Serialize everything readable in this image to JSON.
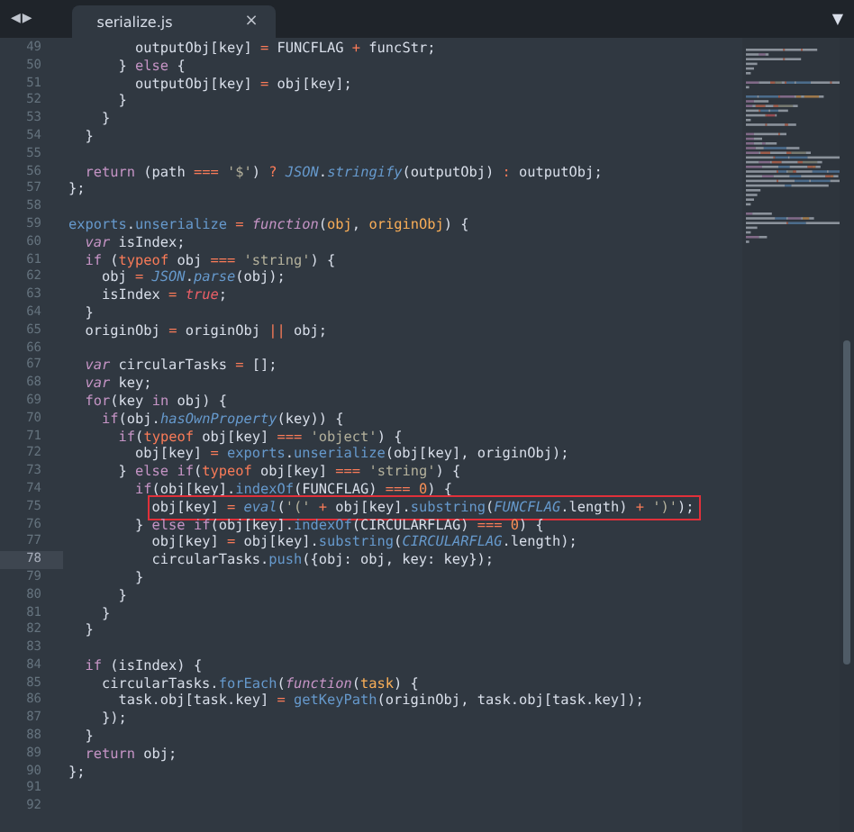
{
  "nav": {
    "back": "◀",
    "forward": "▶"
  },
  "tabs": [
    {
      "label": "serialize.js",
      "close": "×",
      "selected": true
    }
  ],
  "menu": "▼",
  "lines": [
    {
      "n": "49",
      "current": false,
      "boxed": false,
      "tokens": [
        {
          "kind": "plain",
          "text": "        outputObj[key] "
        },
        {
          "kind": "operator",
          "text": "="
        },
        {
          "kind": "plain",
          "text": " FUNCFLAG "
        },
        {
          "kind": "operator",
          "text": "+"
        },
        {
          "kind": "plain",
          "text": " funcStr;"
        }
      ]
    },
    {
      "n": "50",
      "current": false,
      "boxed": false,
      "tokens": [
        {
          "kind": "plain",
          "text": "      } "
        },
        {
          "kind": "keyword",
          "text": "else"
        },
        {
          "kind": "plain",
          "text": " {"
        }
      ]
    },
    {
      "n": "51",
      "current": false,
      "boxed": false,
      "tokens": [
        {
          "kind": "plain",
          "text": "        outputObj[key] "
        },
        {
          "kind": "operator",
          "text": "="
        },
        {
          "kind": "plain",
          "text": " obj[key];"
        }
      ]
    },
    {
      "n": "52",
      "current": false,
      "boxed": false,
      "tokens": [
        {
          "kind": "plain",
          "text": "      }"
        }
      ]
    },
    {
      "n": "53",
      "current": false,
      "boxed": false,
      "tokens": [
        {
          "kind": "plain",
          "text": "    }"
        }
      ]
    },
    {
      "n": "54",
      "current": false,
      "boxed": false,
      "tokens": [
        {
          "kind": "plain",
          "text": "  }"
        }
      ]
    },
    {
      "n": "55",
      "current": false,
      "boxed": false
    },
    {
      "n": "56",
      "current": false,
      "boxed": false,
      "tokens": [
        {
          "kind": "keyword",
          "text": "  return"
        },
        {
          "kind": "plain",
          "text": " (path "
        },
        {
          "kind": "operator",
          "text": "==="
        },
        {
          "kind": "string",
          "text": " '$'"
        },
        {
          "kind": "plain",
          "text": ") "
        },
        {
          "kind": "operator",
          "text": "?"
        },
        {
          "kind": "italic",
          "text": " JSON"
        },
        {
          "kind": "plain",
          "text": "."
        },
        {
          "kind": "italic",
          "text": "stringify"
        },
        {
          "kind": "plain",
          "text": "(outputObj) "
        },
        {
          "kind": "operator",
          "text": ":"
        },
        {
          "kind": "plain",
          "text": " outputObj;"
        }
      ]
    },
    {
      "n": "57",
      "current": false,
      "boxed": false,
      "tokens": [
        {
          "kind": "plain",
          "text": "};"
        }
      ]
    },
    {
      "n": "58",
      "current": false,
      "boxed": false
    },
    {
      "n": "59",
      "current": false,
      "boxed": false,
      "tokens": [
        {
          "kind": "name",
          "text": "exports"
        },
        {
          "kind": "plain",
          "text": "."
        },
        {
          "kind": "name",
          "text": "unserialize "
        },
        {
          "kind": "operator",
          "text": "="
        },
        {
          "kind": "storage",
          "text": " function"
        },
        {
          "kind": "plain",
          "text": "("
        },
        {
          "kind": "param",
          "text": "obj"
        },
        {
          "kind": "plain",
          "text": ", "
        },
        {
          "kind": "param",
          "text": "originObj"
        },
        {
          "kind": "plain",
          "text": ") {"
        }
      ]
    },
    {
      "n": "60",
      "current": false,
      "boxed": false,
      "tokens": [
        {
          "kind": "storage",
          "text": "  var"
        },
        {
          "kind": "plain",
          "text": " isIndex;"
        }
      ]
    },
    {
      "n": "61",
      "current": false,
      "boxed": false,
      "tokens": [
        {
          "kind": "keyword",
          "text": "  if"
        },
        {
          "kind": "plain",
          "text": " ("
        },
        {
          "kind": "operator",
          "text": "typeof"
        },
        {
          "kind": "plain",
          "text": " obj "
        },
        {
          "kind": "operator",
          "text": "==="
        },
        {
          "kind": "string",
          "text": " 'string'"
        },
        {
          "kind": "plain",
          "text": ") {"
        }
      ]
    },
    {
      "n": "62",
      "current": false,
      "boxed": false,
      "tokens": [
        {
          "kind": "plain",
          "text": "    obj "
        },
        {
          "kind": "operator",
          "text": "="
        },
        {
          "kind": "italic",
          "text": " JSON"
        },
        {
          "kind": "plain",
          "text": "."
        },
        {
          "kind": "italic",
          "text": "parse"
        },
        {
          "kind": "plain",
          "text": "(obj);"
        }
      ]
    },
    {
      "n": "63",
      "current": false,
      "boxed": false,
      "tokens": [
        {
          "kind": "plain",
          "text": "    isIndex "
        },
        {
          "kind": "operator",
          "text": "="
        },
        {
          "kind": "bool",
          "text": " true"
        },
        {
          "kind": "plain",
          "text": ";"
        }
      ]
    },
    {
      "n": "64",
      "current": false,
      "boxed": false,
      "tokens": [
        {
          "kind": "plain",
          "text": "  }"
        }
      ]
    },
    {
      "n": "65",
      "current": false,
      "boxed": false,
      "tokens": [
        {
          "kind": "plain",
          "text": "  originObj "
        },
        {
          "kind": "operator",
          "text": "="
        },
        {
          "kind": "plain",
          "text": " originObj "
        },
        {
          "kind": "operator",
          "text": "||"
        },
        {
          "kind": "plain",
          "text": " obj;"
        }
      ]
    },
    {
      "n": "66",
      "current": false,
      "boxed": false
    },
    {
      "n": "67",
      "current": false,
      "boxed": false,
      "tokens": [
        {
          "kind": "storage",
          "text": "  var"
        },
        {
          "kind": "plain",
          "text": " circularTasks "
        },
        {
          "kind": "operator",
          "text": "="
        },
        {
          "kind": "plain",
          "text": " [];"
        }
      ]
    },
    {
      "n": "68",
      "current": false,
      "boxed": false,
      "tokens": [
        {
          "kind": "storage",
          "text": "  var"
        },
        {
          "kind": "plain",
          "text": " key;"
        }
      ]
    },
    {
      "n": "69",
      "current": false,
      "boxed": false,
      "tokens": [
        {
          "kind": "keyword",
          "text": "  for"
        },
        {
          "kind": "plain",
          "text": "(key "
        },
        {
          "kind": "keyword",
          "text": "in"
        },
        {
          "kind": "plain",
          "text": " obj) {"
        }
      ]
    },
    {
      "n": "70",
      "current": false,
      "boxed": false,
      "tokens": [
        {
          "kind": "keyword",
          "text": "    if"
        },
        {
          "kind": "plain",
          "text": "(obj."
        },
        {
          "kind": "italic",
          "text": "hasOwnProperty"
        },
        {
          "kind": "plain",
          "text": "(key)) {"
        }
      ]
    },
    {
      "n": "71",
      "current": false,
      "boxed": false,
      "tokens": [
        {
          "kind": "keyword",
          "text": "      if"
        },
        {
          "kind": "plain",
          "text": "("
        },
        {
          "kind": "operator",
          "text": "typeof"
        },
        {
          "kind": "plain",
          "text": " obj[key] "
        },
        {
          "kind": "operator",
          "text": "==="
        },
        {
          "kind": "string",
          "text": " 'object'"
        },
        {
          "kind": "plain",
          "text": ") {"
        }
      ]
    },
    {
      "n": "72",
      "current": false,
      "boxed": false,
      "tokens": [
        {
          "kind": "plain",
          "text": "        obj[key] "
        },
        {
          "kind": "operator",
          "text": "="
        },
        {
          "kind": "name",
          "text": " exports"
        },
        {
          "kind": "plain",
          "text": "."
        },
        {
          "kind": "name",
          "text": "unserialize"
        },
        {
          "kind": "plain",
          "text": "(obj[key], originObj);"
        }
      ]
    },
    {
      "n": "73",
      "current": false,
      "boxed": false,
      "tokens": [
        {
          "kind": "plain",
          "text": "      } "
        },
        {
          "kind": "keyword",
          "text": "else if"
        },
        {
          "kind": "plain",
          "text": "("
        },
        {
          "kind": "operator",
          "text": "typeof"
        },
        {
          "kind": "plain",
          "text": " obj[key] "
        },
        {
          "kind": "operator",
          "text": "==="
        },
        {
          "kind": "string",
          "text": " 'string'"
        },
        {
          "kind": "plain",
          "text": ") {"
        }
      ]
    },
    {
      "n": "74",
      "current": false,
      "boxed": false,
      "tokens": [
        {
          "kind": "keyword",
          "text": "        if"
        },
        {
          "kind": "plain",
          "text": "(obj[key]."
        },
        {
          "kind": "name",
          "text": "indexOf"
        },
        {
          "kind": "plain",
          "text": "(FUNCFLAG) "
        },
        {
          "kind": "operator",
          "text": "==="
        },
        {
          "kind": "number",
          "text": " 0"
        },
        {
          "kind": "plain",
          "text": ") {"
        }
      ]
    },
    {
      "n": "75",
      "current": false,
      "boxed": true,
      "tokens": [
        {
          "kind": "plain",
          "text": "          obj[key] "
        },
        {
          "kind": "operator",
          "text": "="
        },
        {
          "kind": "italic",
          "text": " eval"
        },
        {
          "kind": "plain",
          "text": "("
        },
        {
          "kind": "string",
          "text": "'('"
        },
        {
          "kind": "operator",
          "text": " +"
        },
        {
          "kind": "plain",
          "text": " obj[key]."
        },
        {
          "kind": "name",
          "text": "substring"
        },
        {
          "kind": "plain",
          "text": "("
        },
        {
          "kind": "italic",
          "text": "FUNCFLAG"
        },
        {
          "kind": "plain",
          "text": ".length) "
        },
        {
          "kind": "operator",
          "text": "+"
        },
        {
          "kind": "string",
          "text": " ')'"
        },
        {
          "kind": "plain",
          "text": ");"
        }
      ]
    },
    {
      "n": "76",
      "current": false,
      "boxed": false,
      "tokens": [
        {
          "kind": "plain",
          "text": "        } "
        },
        {
          "kind": "keyword",
          "text": "else if"
        },
        {
          "kind": "plain",
          "text": "(obj[key]."
        },
        {
          "kind": "name",
          "text": "indexOf"
        },
        {
          "kind": "plain",
          "text": "(CIRCULARFLAG) "
        },
        {
          "kind": "operator",
          "text": "==="
        },
        {
          "kind": "number",
          "text": " 0"
        },
        {
          "kind": "plain",
          "text": ") {"
        }
      ]
    },
    {
      "n": "77",
      "current": false,
      "boxed": false,
      "tokens": [
        {
          "kind": "plain",
          "text": "          obj[key] "
        },
        {
          "kind": "operator",
          "text": "="
        },
        {
          "kind": "plain",
          "text": " obj[key]."
        },
        {
          "kind": "name",
          "text": "substring"
        },
        {
          "kind": "plain",
          "text": "("
        },
        {
          "kind": "italic",
          "text": "CIRCULARFLAG"
        },
        {
          "kind": "plain",
          "text": ".length);"
        }
      ]
    },
    {
      "n": "78",
      "current": true,
      "boxed": false,
      "tokens": [
        {
          "kind": "plain",
          "text": "          circularTasks."
        },
        {
          "kind": "name",
          "text": "push"
        },
        {
          "kind": "plain",
          "text": "({obj: obj, key: key});"
        }
      ]
    },
    {
      "n": "79",
      "current": false,
      "boxed": false,
      "tokens": [
        {
          "kind": "plain",
          "text": "        }"
        }
      ]
    },
    {
      "n": "80",
      "current": false,
      "boxed": false,
      "tokens": [
        {
          "kind": "plain",
          "text": "      }"
        }
      ]
    },
    {
      "n": "81",
      "current": false,
      "boxed": false,
      "tokens": [
        {
          "kind": "plain",
          "text": "    }"
        }
      ]
    },
    {
      "n": "82",
      "current": false,
      "boxed": false,
      "tokens": [
        {
          "kind": "plain",
          "text": "  }"
        }
      ]
    },
    {
      "n": "83",
      "current": false,
      "boxed": false
    },
    {
      "n": "84",
      "current": false,
      "boxed": false,
      "tokens": [
        {
          "kind": "keyword",
          "text": "  if"
        },
        {
          "kind": "plain",
          "text": " (isIndex) {"
        }
      ]
    },
    {
      "n": "85",
      "current": false,
      "boxed": false,
      "tokens": [
        {
          "kind": "plain",
          "text": "    circularTasks."
        },
        {
          "kind": "name",
          "text": "forEach"
        },
        {
          "kind": "plain",
          "text": "("
        },
        {
          "kind": "storage",
          "text": "function"
        },
        {
          "kind": "plain",
          "text": "("
        },
        {
          "kind": "param",
          "text": "task"
        },
        {
          "kind": "plain",
          "text": ") {"
        }
      ]
    },
    {
      "n": "86",
      "current": false,
      "boxed": false,
      "tokens": [
        {
          "kind": "plain",
          "text": "      task.obj[task.key] "
        },
        {
          "kind": "operator",
          "text": "="
        },
        {
          "kind": "name",
          "text": " getKeyPath"
        },
        {
          "kind": "plain",
          "text": "(originObj, task.obj[task.key]);"
        }
      ]
    },
    {
      "n": "87",
      "current": false,
      "boxed": false,
      "tokens": [
        {
          "kind": "plain",
          "text": "    });"
        }
      ]
    },
    {
      "n": "88",
      "current": false,
      "boxed": false,
      "tokens": [
        {
          "kind": "plain",
          "text": "  }"
        }
      ]
    },
    {
      "n": "89",
      "current": false,
      "boxed": false,
      "tokens": [
        {
          "kind": "keyword",
          "text": "  return"
        },
        {
          "kind": "plain",
          "text": " obj;"
        }
      ]
    },
    {
      "n": "90",
      "current": false,
      "boxed": false,
      "tokens": [
        {
          "kind": "plain",
          "text": "};"
        }
      ]
    },
    {
      "n": "91",
      "current": false,
      "boxed": false
    },
    {
      "n": "92",
      "current": false,
      "boxed": false
    }
  ]
}
